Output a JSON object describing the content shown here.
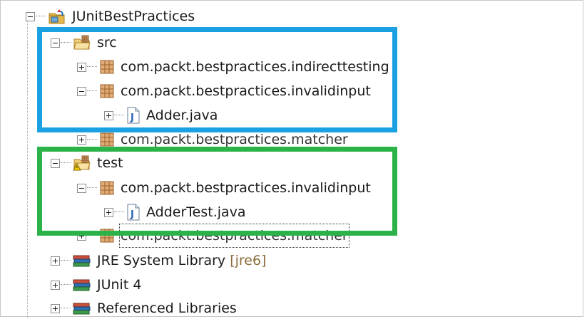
{
  "tree": {
    "project": {
      "label": "JUnitBestPractices",
      "icon": "java-project-icon",
      "expanded": true
    },
    "src": {
      "label": "src",
      "icon": "source-folder-icon",
      "expanded": true,
      "packages": [
        {
          "label": "com.packt.bestpractices.indirecttesting",
          "icon": "package-icon",
          "expanded": false
        },
        {
          "label": "com.packt.bestpractices.invalidinput",
          "icon": "package-icon",
          "expanded": true,
          "files": [
            {
              "label": "Adder.java",
              "icon": "java-file-icon"
            }
          ]
        },
        {
          "label": "com.packt.bestpractices.matcher",
          "icon": "package-icon",
          "expanded": false
        }
      ]
    },
    "test": {
      "label": "test",
      "icon": "source-folder-warning-icon",
      "expanded": true,
      "packages": [
        {
          "label": "com.packt.bestpractices.invalidinput",
          "icon": "package-icon",
          "expanded": true,
          "files": [
            {
              "label": "AdderTest.java",
              "icon": "java-file-icon"
            }
          ]
        },
        {
          "label": "com.packt.bestpractices.matcher",
          "icon": "package-icon",
          "expanded": false,
          "focused": true
        }
      ]
    },
    "libraries": [
      {
        "label": "JRE System Library",
        "decorator": "[jre6]",
        "icon": "library-icon"
      },
      {
        "label": "JUnit 4",
        "icon": "library-icon"
      },
      {
        "label": "Referenced Libraries",
        "icon": "library-icon"
      }
    ]
  },
  "highlights": {
    "src_box_color": "#1ba1e2",
    "test_box_color": "#2bb34a"
  }
}
